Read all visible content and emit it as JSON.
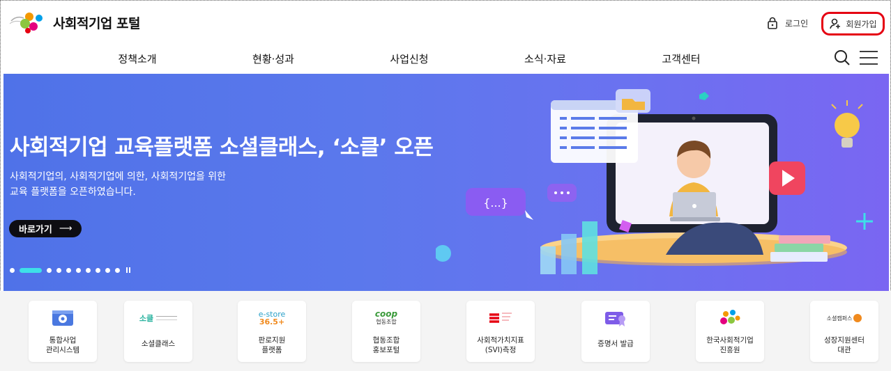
{
  "header": {
    "logo_text": "사회적기업 포털",
    "login_label": "로그인",
    "signup_label": "회원가입"
  },
  "nav": {
    "items": [
      "정책소개",
      "현황·성과",
      "사업신청",
      "소식·자료",
      "고객센터"
    ]
  },
  "banner": {
    "title": "사회적기업 교육플랫폼 소셜클래스, ‘소클’ 오픈",
    "desc_line1": "사회적기업의, 사회적기업에 의한, 사회적기업을 위한",
    "desc_line2": "교육 플랫폼을 오픈하였습니다.",
    "button_label": "바로가기",
    "button_arrow": "⟶",
    "slide_count": 10,
    "active_slide": 1,
    "code_bubble_text": "{...}"
  },
  "quick_links": [
    {
      "line1": "통합사업",
      "line2": "관리시스템",
      "icon": "gear-monitor-icon"
    },
    {
      "line1": "소셜클래스",
      "line2": "",
      "icon": "soclass-logo",
      "logo_text": "소클"
    },
    {
      "line1": "판로지원",
      "line2": "플랫폼",
      "icon": "estore-logo",
      "logo_text1": "e-store",
      "logo_text2": "36.5+"
    },
    {
      "line1": "협동조합",
      "line2": "홍보포털",
      "icon": "coop-logo",
      "logo_text1": "coop",
      "logo_text2": "협동조합"
    },
    {
      "line1": "사회적가치지표",
      "line2": "(SVI)측정",
      "icon": "svi-logo"
    },
    {
      "line1": "증명서 발급",
      "line2": "",
      "icon": "certificate-icon"
    },
    {
      "line1": "한국사회적기업",
      "line2": "진흥원",
      "icon": "kosea-logo"
    },
    {
      "line1": "성장지원센터",
      "line2": "대관",
      "icon": "campus-logo",
      "logo_text": "소셜캠퍼스"
    }
  ],
  "colors": {
    "banner_start": "#4f72e8",
    "banner_end": "#7a66f2",
    "signup_highlight": "#e50012",
    "active_dot": "#3de0e8"
  }
}
